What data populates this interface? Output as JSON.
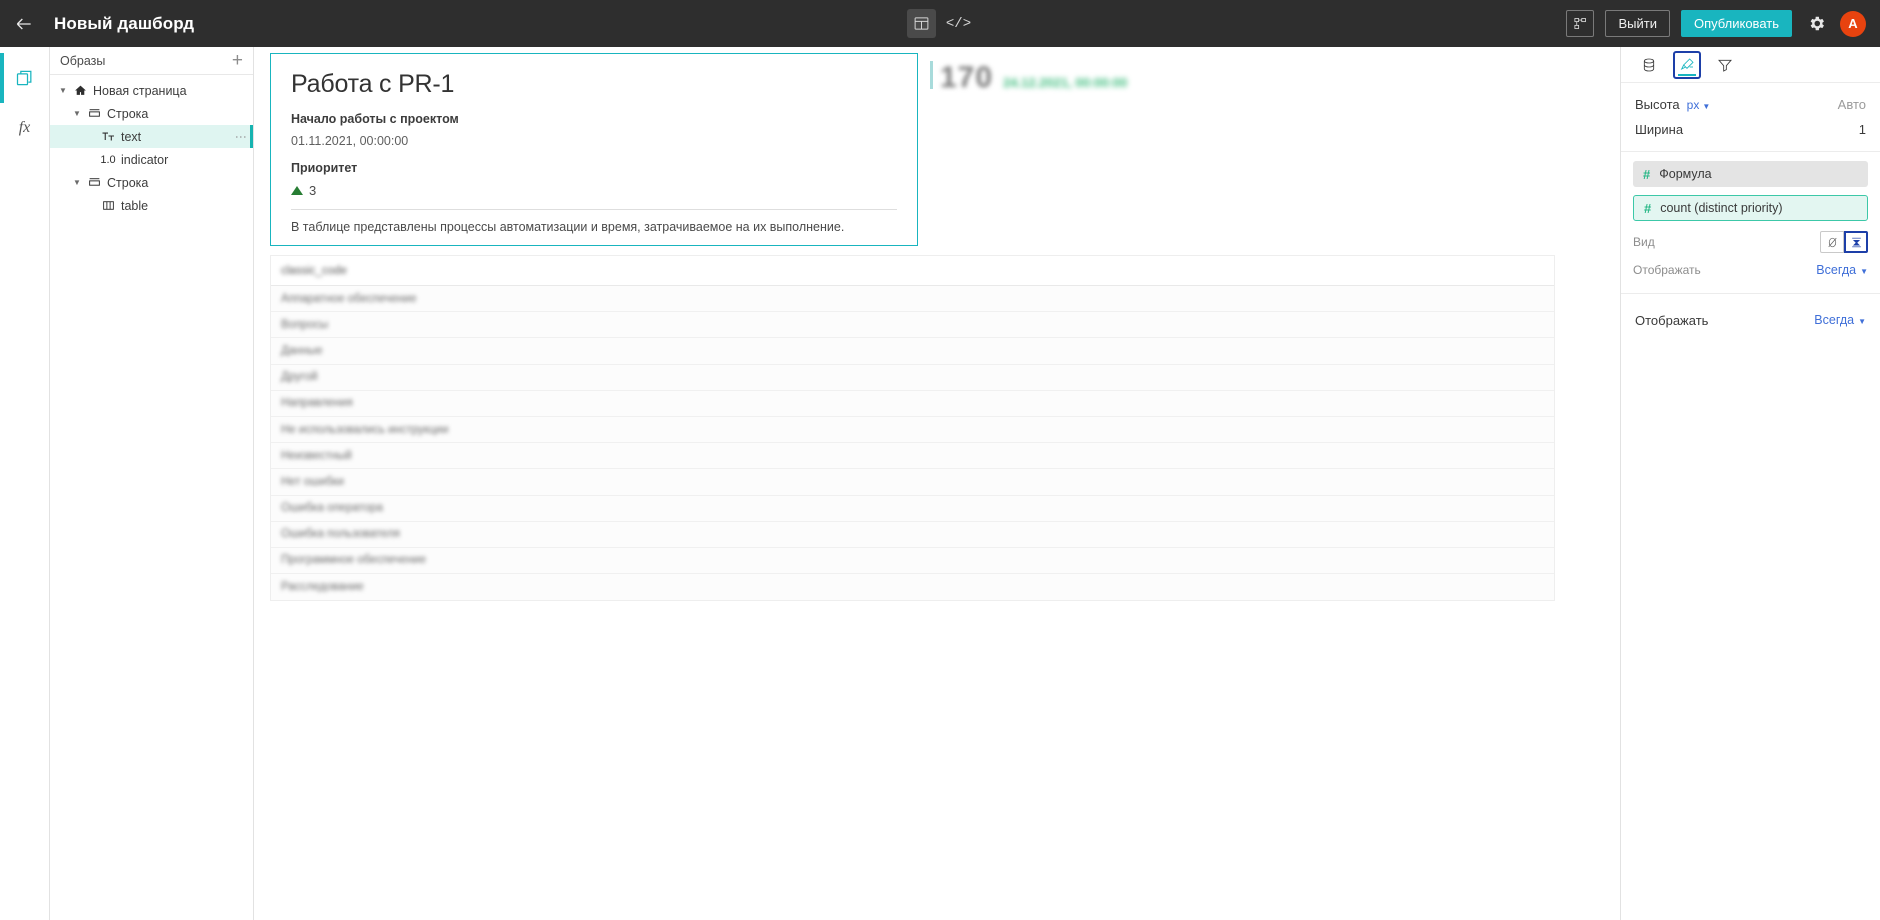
{
  "topbar": {
    "back_icon": "arrow-left-icon",
    "title": "Новый дашборд",
    "center_tools": [
      {
        "icon": "layout-panel-icon",
        "active": true
      },
      {
        "icon": "code-brackets-icon",
        "label": "</>",
        "active": false
      }
    ],
    "share_icon": "share-nodes-icon",
    "logout_label": "Выйти",
    "publish_label": "Опубликовать",
    "settings_icon": "gear-icon",
    "avatar_label": "A"
  },
  "rail": {
    "items": [
      {
        "icon": "layers-copy-icon",
        "active": true
      },
      {
        "icon": "fx-icon",
        "label": "fx",
        "active": false
      }
    ]
  },
  "tree": {
    "header_title": "Образы",
    "add_label": "+",
    "items": [
      {
        "label": "Новая страница",
        "icon": "home-icon",
        "indent": 0,
        "caret": "▼",
        "selected": false
      },
      {
        "label": "Строка",
        "icon": "row-icon",
        "indent": 1,
        "caret": "▼",
        "selected": false
      },
      {
        "label": "text",
        "icon": "text-icon",
        "indent": 2,
        "caret": "",
        "selected": true
      },
      {
        "label": "indicator",
        "icon": "number-icon",
        "icon_text": "1.0",
        "indent": 2,
        "caret": "",
        "selected": false
      },
      {
        "label": "Строка",
        "icon": "row-icon",
        "indent": 1,
        "caret": "▼",
        "selected": false
      },
      {
        "label": "table",
        "icon": "table-icon",
        "indent": 2,
        "caret": "",
        "selected": false
      }
    ]
  },
  "canvas": {
    "text_card": {
      "title": "Работа с PR-1",
      "subtitle": "Начало работы с проектом",
      "date_value": "01.11.2021, 00:00:00",
      "priority_label": "Приоритет",
      "priority_value": "3",
      "priority_trend_icon": "triangle-up-icon",
      "note": "В таблице представлены процессы автоматизации и время, затрачиваемое на их выполнение."
    },
    "indicator": {
      "value": "170",
      "date": "24.12.2021, 00:00:00"
    },
    "table": {
      "header": "classic_code",
      "rows": [
        "Аппаратное обеспечение",
        "Вопросы",
        "Данные",
        "Другой",
        "Направления",
        "Не использовались инструкции",
        "Неизвестный",
        "Нет ошибки",
        "Ошибка оператора",
        "Ошибка пользователя",
        "Программное обеспечение",
        "Расследование"
      ]
    }
  },
  "right_panel": {
    "tabs": [
      {
        "icon": "database-icon",
        "active": false
      },
      {
        "icon": "brush-icon",
        "active": true
      },
      {
        "icon": "funnel-filter-icon",
        "active": false
      }
    ],
    "height_label": "Высота",
    "height_unit": "px",
    "height_value": "Авто",
    "width_label": "Ширина",
    "width_value": "1",
    "formula_chip": "Формула",
    "selected_chip": "count (distinct priority)",
    "view_label": "Вид",
    "view_options": [
      {
        "icon": "no-format-icon",
        "active": false
      },
      {
        "icon": "collapse-icon",
        "active": true
      }
    ],
    "display_label_1": "Отображать",
    "display_value_1": "Всегда",
    "display_label_2": "Отображать",
    "display_value_2": "Всегда"
  },
  "colors": {
    "accent_teal": "#19b5bf",
    "topbar_bg": "#2e2e2e",
    "publish_bg": "#19b5bf",
    "avatar_bg": "#e8430f",
    "link_blue": "#3f6fd8",
    "focus_blue": "#1d3fa8",
    "chip_green": "#28b887",
    "trend_green": "#277d33",
    "indicator_date_green": "#3fbd7e"
  }
}
